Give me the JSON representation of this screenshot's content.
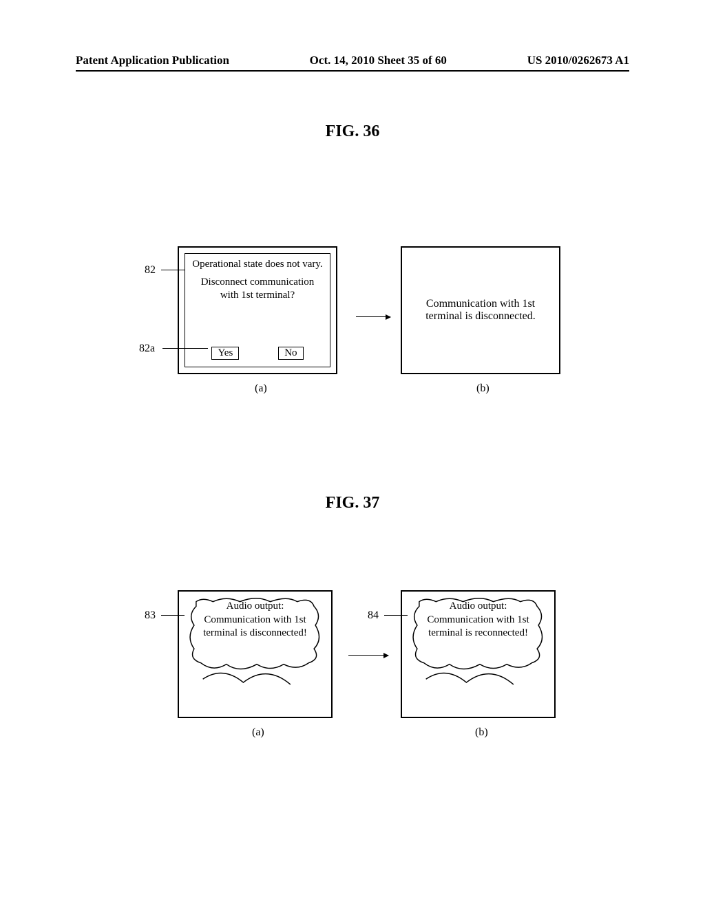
{
  "header": {
    "left": "Patent Application Publication",
    "center": "Oct. 14, 2010  Sheet 35 of 60",
    "right": "US 2010/0262673 A1"
  },
  "fig36": {
    "title": "FIG. 36",
    "refs": {
      "r82": "82",
      "r82a": "82a"
    },
    "screen_a": {
      "line1": "Operational state does not vary.",
      "line2": "Disconnect communication with 1st terminal?",
      "yes": "Yes",
      "no": "No",
      "caption": "(a)"
    },
    "screen_b": {
      "text": "Communication with 1st terminal is disconnected.",
      "caption": "(b)"
    }
  },
  "fig37": {
    "title": "FIG. 37",
    "refs": {
      "r83": "83",
      "r84": "84"
    },
    "screen_a": {
      "text": "Audio output: Communication with 1st terminal is disconnected!",
      "caption": "(a)"
    },
    "screen_b": {
      "text": "Audio output: Communication with 1st terminal is reconnected!",
      "caption": "(b)"
    }
  }
}
